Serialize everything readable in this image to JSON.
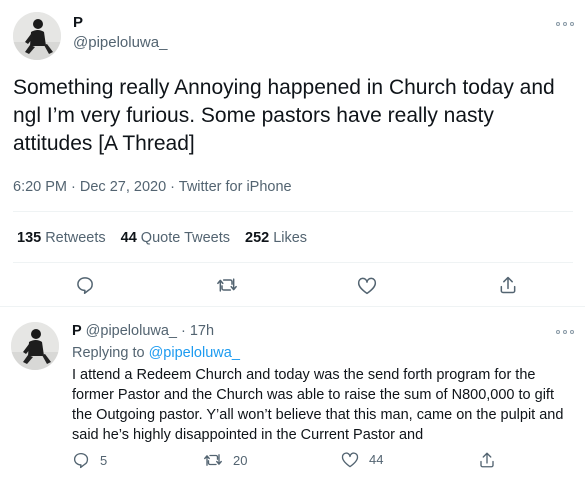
{
  "main_tweet": {
    "display_name": "P",
    "handle": "@pipeloluwa_",
    "text": "Something really Annoying happened in Church today and ngl I’m very furious. Some pastors have really nasty attitudes [A Thread]",
    "meta": "6:20 PM · Dec 27, 2020 · Twitter for iPhone",
    "stats": {
      "retweets_count": "135",
      "retweets_label": "Retweets",
      "quotes_count": "44",
      "quotes_label": "Quote Tweets",
      "likes_count": "252",
      "likes_label": "Likes"
    }
  },
  "reply_tweet": {
    "display_name": "P",
    "handle_time": "@pipeloluwa_ · 17h",
    "replying_prefix": "Replying to",
    "replying_to": "@pipeloluwa_",
    "text": "I attend a Redeem Church and today was the send forth program for the former Pastor and the Church was able to raise the sum of N800,000 to gift the Outgoing pastor. Y’all won’t believe that this man, came on the pulpit and said he’s highly disappointed in the Current Pastor and",
    "reply_count": "5",
    "retweet_count": "20",
    "like_count": "44"
  },
  "icons": {
    "more": "more-icon",
    "reply": "reply-icon",
    "retweet": "retweet-icon",
    "like": "heart-icon",
    "share": "share-icon"
  },
  "colors": {
    "text": "#0f1419",
    "secondary": "#536471",
    "link": "#1d9bf0",
    "divider": "#eff3f4"
  }
}
